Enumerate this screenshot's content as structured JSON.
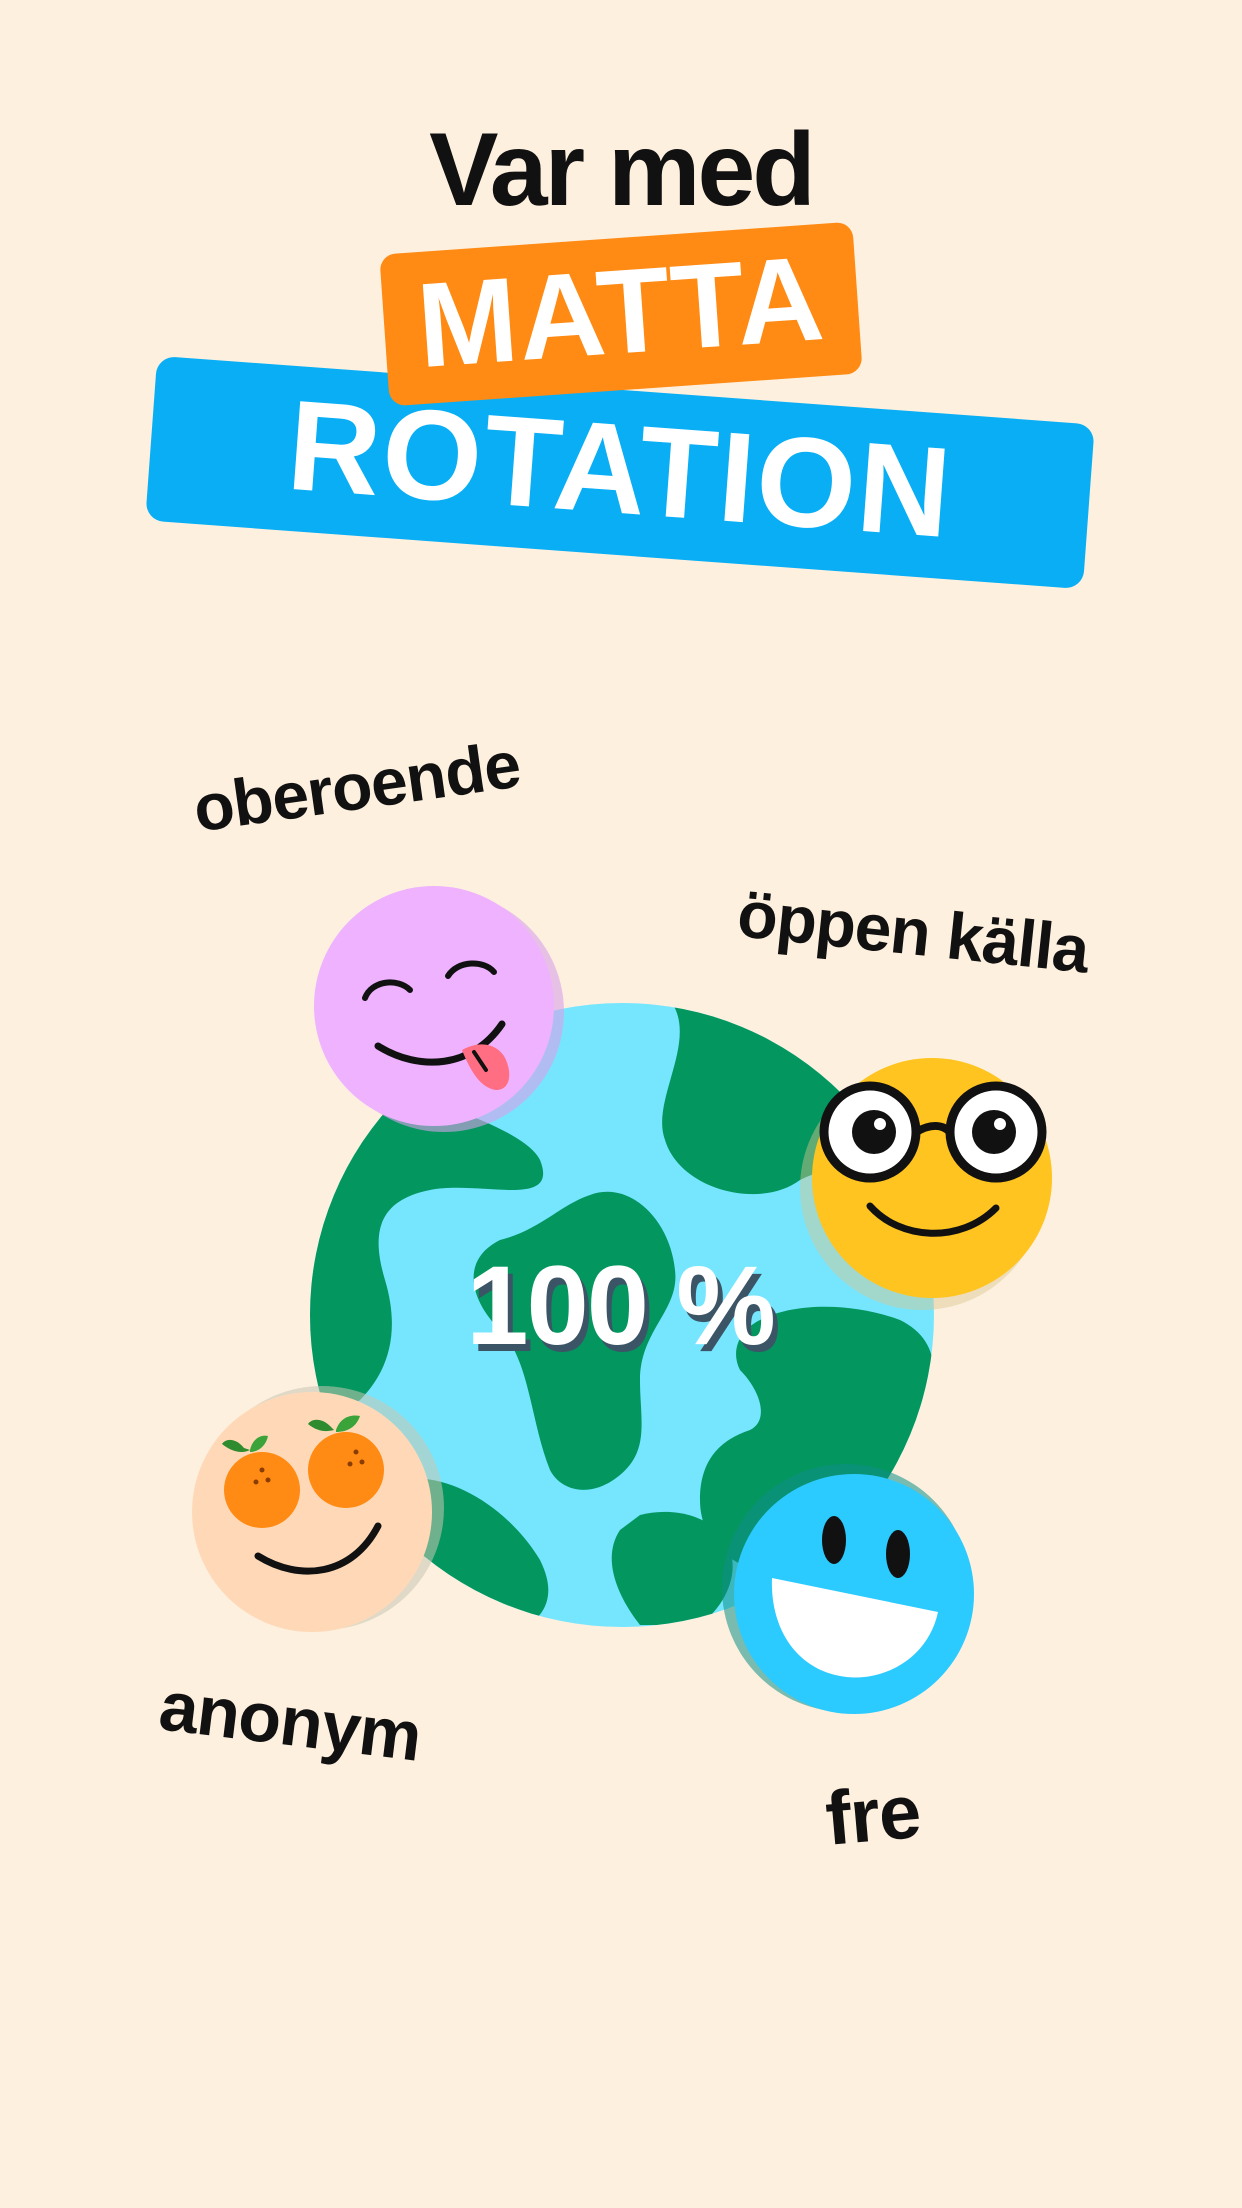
{
  "headline": "Var med",
  "badge_top": "MATTA",
  "badge_bottom": "ROTATION",
  "center_value": "100 %",
  "labels": {
    "top_left": "oberoende",
    "top_right": "öppen källa",
    "bottom_left": "anonym",
    "bottom_right": "fre"
  },
  "colors": {
    "background": "#FDF0DF",
    "orange": "#FF8A14",
    "blue": "#09AEF5",
    "globe_ocean": "#76E6FF",
    "globe_land": "#03965F",
    "face_pink": "#EEB2FF",
    "face_yellow": "#FFC41F",
    "face_peach": "#FFD9B7",
    "face_blue": "#2BCAFF"
  },
  "icons": [
    "globe-icon",
    "tongue-face-icon",
    "glasses-face-icon",
    "orange-eyes-face-icon",
    "grin-face-icon"
  ]
}
